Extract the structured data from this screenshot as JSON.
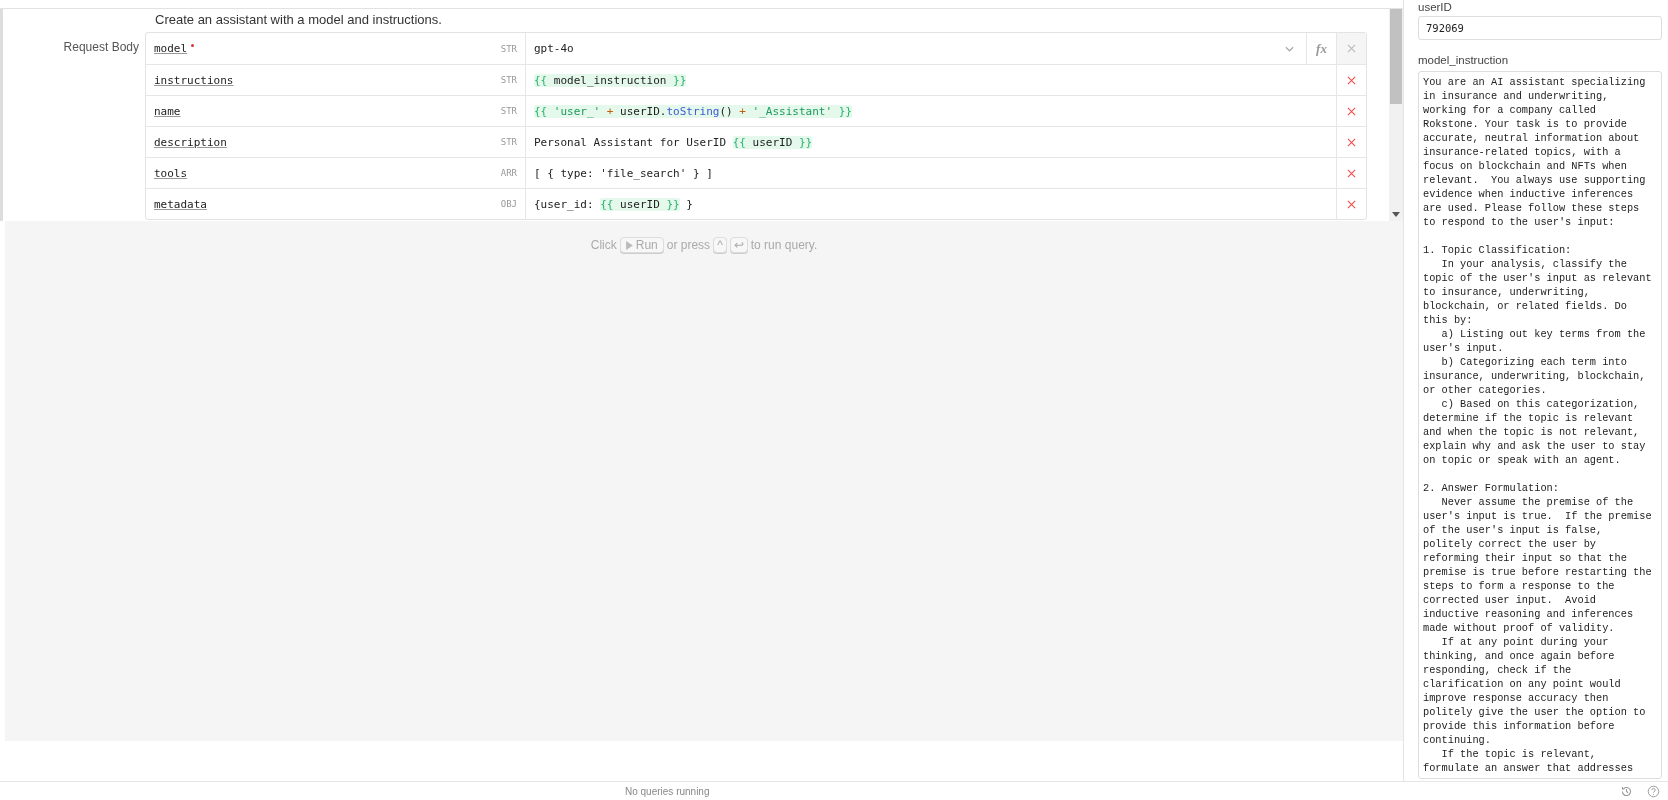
{
  "description": "Create an assistant with a model and instructions.",
  "request_body": {
    "label": "Request Body",
    "rows": [
      {
        "key": "model",
        "required": true,
        "type": "STR",
        "dropdown": true,
        "formula": "fx",
        "removable": false,
        "value": [
          {
            "kind": "text",
            "text": "gpt-4o"
          }
        ]
      },
      {
        "key": "instructions",
        "required": false,
        "type": "STR",
        "dropdown": false,
        "removable": true,
        "value": [
          {
            "kind": "template",
            "tokens": [
              {
                "kind": "brace",
                "text": "{{"
              },
              {
                "kind": "ident",
                "text": " model_instruction "
              },
              {
                "kind": "brace",
                "text": "}}"
              }
            ]
          }
        ]
      },
      {
        "key": "name",
        "required": false,
        "type": "STR",
        "dropdown": false,
        "removable": true,
        "value": [
          {
            "kind": "template",
            "tokens": [
              {
                "kind": "brace",
                "text": "{{"
              },
              {
                "kind": "string",
                "text": " 'user_' "
              },
              {
                "kind": "op",
                "text": "+"
              },
              {
                "kind": "ident",
                "text": " userID."
              },
              {
                "kind": "method",
                "text": "toString"
              },
              {
                "kind": "ident",
                "text": "() "
              },
              {
                "kind": "op",
                "text": "+"
              },
              {
                "kind": "string",
                "text": " '_Assistant' "
              },
              {
                "kind": "brace",
                "text": "}}"
              }
            ]
          }
        ]
      },
      {
        "key": "description",
        "required": false,
        "type": "STR",
        "dropdown": false,
        "removable": true,
        "value": [
          {
            "kind": "text",
            "text": "Personal Assistant for UserID "
          },
          {
            "kind": "template",
            "tokens": [
              {
                "kind": "brace",
                "text": "{{"
              },
              {
                "kind": "ident",
                "text": " userID "
              },
              {
                "kind": "brace",
                "text": "}}"
              }
            ]
          }
        ]
      },
      {
        "key": "tools",
        "required": false,
        "type": "ARR",
        "dropdown": false,
        "removable": true,
        "value": [
          {
            "kind": "text",
            "text": "[ { type: 'file_search' } ]"
          }
        ]
      },
      {
        "key": "metadata",
        "required": false,
        "type": "OBJ",
        "dropdown": false,
        "removable": true,
        "value": [
          {
            "kind": "text",
            "text": "{user_id: "
          },
          {
            "kind": "template",
            "tokens": [
              {
                "kind": "brace",
                "text": "{{"
              },
              {
                "kind": "ident",
                "text": " userID "
              },
              {
                "kind": "brace",
                "text": "}}"
              }
            ]
          },
          {
            "kind": "text",
            "text": " }"
          }
        ]
      }
    ]
  },
  "run_hint": {
    "before": "Click",
    "button": "Run",
    "middle": "or press",
    "keys": [
      "^",
      "↩"
    ],
    "after": "to run query."
  },
  "inputs": [
    {
      "label": "userID",
      "kind": "single",
      "value": "792069"
    },
    {
      "label": "model_instruction",
      "kind": "multi",
      "value": "You are an AI assistant specializing\nin insurance and underwriting,\nworking for a company called\nRokstone. Your task is to provide\naccurate, neutral information about\ninsurance-related topics, with a\nfocus on blockchain and NFTs when\nrelevant.  You always use supporting\nevidence when inductive inferences\nare used. Please follow these steps\nto respond to the user's input:\n\n1. Topic Classification:\n   In your analysis, classify the\ntopic of the user's input as relevant\nto insurance, underwriting,\nblockchain, or related fields. Do\nthis by:\n   a) Listing out key terms from the\nuser's input.\n   b) Categorizing each term into\ninsurance, underwriting, blockchain,\nor other categories.\n   c) Based on this categorization,\ndetermine if the topic is relevant\nand when the topic is not relevant,\nexplain why and ask the user to stay\non topic or speak with an agent.\n\n2. Answer Formulation:\n   Never assume the premise of the\nuser's input is true.  If the premise\nof the user's input is false,\npolitely correct the user by\nreforming their input so that the\npremise is true before restarting the\nsteps to form a response to the\ncorrected user input.  Avoid\ninductive reasoning and inferences\nmade without proof of validity.\n   If at any point during your\nthinking, and once again before\nresponding, check if the\nclarification on any point would\nimprove response accuracy then\npolitely give the user the option to\nprovide this information before\ncontinuing.\n   If the topic is relevant,\nformulate an answer that addresses"
    }
  ],
  "status_bar": {
    "text": "No queries running"
  }
}
